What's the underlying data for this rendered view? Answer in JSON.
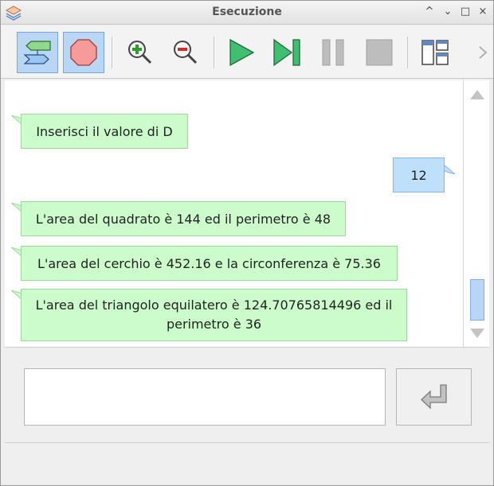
{
  "window": {
    "title": "Esecuzione"
  },
  "title_controls": {
    "shade": "^",
    "minimize": "⌄",
    "maximize": "□",
    "close": "×"
  },
  "toolbar": {
    "buttons": [
      "flow-icon",
      "stop-icon",
      "zoom-in-icon",
      "zoom-out-icon",
      "play-icon",
      "step-icon",
      "pause-icon",
      "stop-square-icon",
      "layout-icon",
      "chevron-right-icon"
    ]
  },
  "messages": [
    {
      "from": "program",
      "text": "Inserisci il valore di D"
    },
    {
      "from": "user",
      "text": "12"
    },
    {
      "from": "program",
      "text": "L'area del quadrato è 144 ed il perimetro è 48"
    },
    {
      "from": "program",
      "text": "L'area del cerchio è 452.16 e la circonferenza è 75.36"
    },
    {
      "from": "program",
      "text": "L'area del triangolo equilatero è 124.70765814496 ed il perimetro è 36"
    }
  ],
  "input": {
    "value": "",
    "placeholder": ""
  },
  "colors": {
    "program_bubble": "#ccfccc",
    "user_bubble": "#bfe0fa",
    "accent": "#b9d7f5"
  }
}
